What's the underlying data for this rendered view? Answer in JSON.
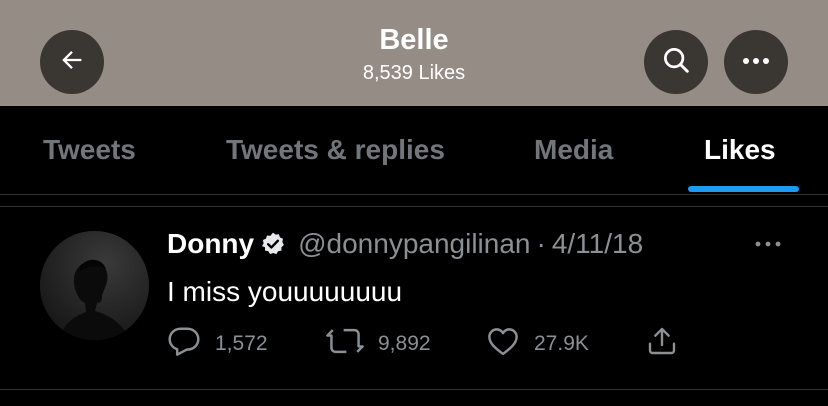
{
  "header": {
    "title": "Belle",
    "subtitle": "8,539 Likes",
    "background_color": "#948c85",
    "buttons": [
      "back-arrow-icon",
      "search-icon",
      "more-icon"
    ]
  },
  "tabs": [
    {
      "label": "Tweets",
      "active": false
    },
    {
      "label": "Tweets & replies",
      "active": false
    },
    {
      "label": "Media",
      "active": false
    },
    {
      "label": "Likes",
      "active": true
    }
  ],
  "accent_color": "#1d9bf0",
  "tweet": {
    "name": "Donny",
    "verified": true,
    "handle": "@donnypangilinan",
    "separator": "·",
    "date": "4/11/18",
    "text": "I miss youuuuuuuu",
    "actions": {
      "replies": "1,572",
      "retweets": "9,892",
      "likes": "27.9K"
    }
  }
}
